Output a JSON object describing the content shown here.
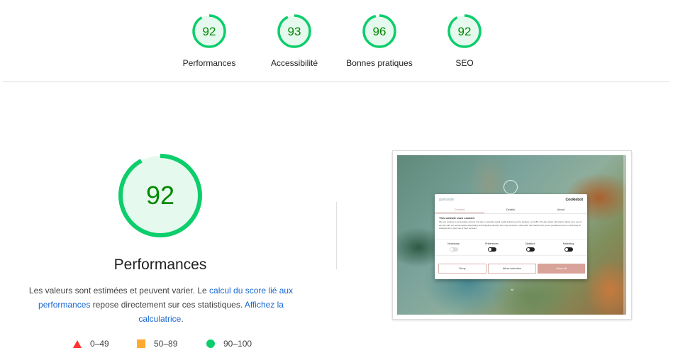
{
  "colors": {
    "pass": "#0cce6b",
    "pass_text": "#008800",
    "pass_bg": "#e6f9ee",
    "average": "#ffaa33",
    "fail": "#ff3333",
    "link": "#1967d2"
  },
  "summary": {
    "gauges": [
      {
        "label": "Performances",
        "score": 92
      },
      {
        "label": "Accessibilité",
        "score": 93
      },
      {
        "label": "Bonnes pratiques",
        "score": 96
      },
      {
        "label": "SEO",
        "score": 92
      }
    ]
  },
  "main": {
    "score": 92,
    "title": "Performances",
    "description": {
      "part1": "Les valeurs sont estimées et peuvent varier. Le ",
      "link1": "calcul du score lié aux performances",
      "part2": " repose directement sur ces statistiques. ",
      "link2": "Affichez la calculatrice",
      "part3": "."
    },
    "legend": [
      {
        "icon": "triangle-icon",
        "range": "0–49"
      },
      {
        "icon": "square-icon",
        "range": "50–89"
      },
      {
        "icon": "circle-icon",
        "range": "90–100"
      }
    ]
  },
  "screenshot": {
    "cookie": {
      "brand": "guérande",
      "powered": "Cookiebot",
      "tabs": [
        "Consent",
        "Details",
        "About"
      ],
      "heading": "This website uses cookies",
      "body": "We use cookies to personalise content and ads, to provide social media features and to analyse our traffic. We also share information about your use of our site with our social media, advertising and analytics partners who may combine it with other information that you've provided to them or that they've collected from your use of their services.",
      "toggles": [
        {
          "label": "Necessary",
          "on": false
        },
        {
          "label": "Preferences",
          "on": true
        },
        {
          "label": "Statistics",
          "on": true
        },
        {
          "label": "Marketing",
          "on": true
        }
      ],
      "buttons": {
        "deny": "Deny",
        "selection": "Allow selection",
        "all": "Allow all"
      }
    }
  }
}
